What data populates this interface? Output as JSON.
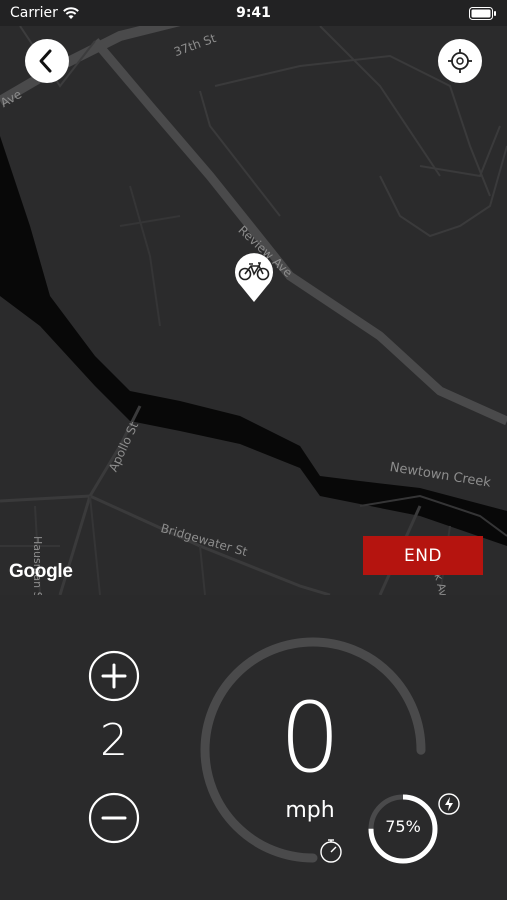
{
  "status_bar": {
    "carrier": "Carrier",
    "time": "9:41"
  },
  "map": {
    "street_labels": [
      {
        "id": "37th",
        "text": "37th St"
      },
      {
        "id": "ave-left",
        "text": "Ave"
      },
      {
        "id": "review",
        "text": "Review Ave"
      },
      {
        "id": "apollo",
        "text": "Apollo St"
      },
      {
        "id": "newtown",
        "text": "Newtown Creek"
      },
      {
        "id": "bridgewater",
        "text": "Bridgewater St"
      },
      {
        "id": "hausman",
        "text": "Hausman St"
      },
      {
        "id": "varick",
        "text": "Varick Ave"
      }
    ],
    "google_logo": "Google",
    "end_button": "END",
    "pin_icon": "bicycle-icon"
  },
  "ride_panel": {
    "assist_level": "2",
    "speed": "0",
    "speed_unit": "mph",
    "speed_gauge_fraction": 0.75,
    "battery_percent_label": "75%",
    "battery_fraction": 0.75,
    "icons": [
      "plus-icon",
      "minus-icon",
      "speedometer-icon",
      "lightning-bolt-icon"
    ]
  }
}
